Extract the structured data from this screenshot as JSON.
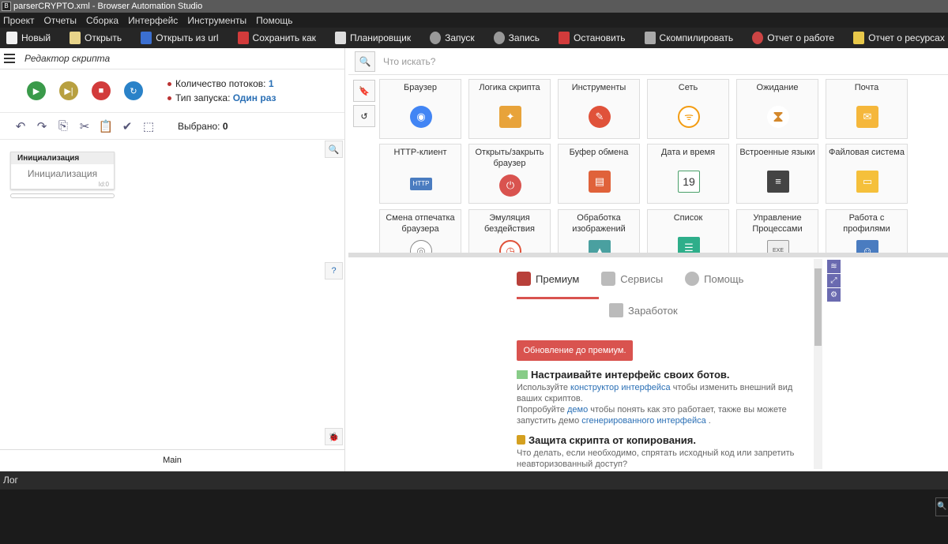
{
  "window": {
    "title": "parserCRYPTO.xml - Browser Automation Studio"
  },
  "menu": [
    "Проект",
    "Отчеты",
    "Сборка",
    "Интерфейс",
    "Инструменты",
    "Помощь"
  ],
  "toolbar": [
    {
      "label": "Новый",
      "icon": "new-file-icon",
      "color": "#f0f0f0"
    },
    {
      "label": "Открыть",
      "icon": "open-folder-icon",
      "color": "#e8d48a"
    },
    {
      "label": "Открыть из url",
      "icon": "download-arrow-icon",
      "color": "#3b6fd0"
    },
    {
      "label": "Сохранить как",
      "icon": "save-icon",
      "color": "#d23b3b"
    },
    {
      "label": "Планировщик",
      "icon": "calendar-icon",
      "color": "#ddd"
    },
    {
      "label": "Запуск",
      "icon": "play-icon",
      "color": "#999"
    },
    {
      "label": "Запись",
      "icon": "record-icon",
      "color": "#999"
    },
    {
      "label": "Остановить",
      "icon": "stop-icon",
      "color": "#d23b3b"
    },
    {
      "label": "Скомпилировать",
      "icon": "cube-icon",
      "color": "#aaa"
    },
    {
      "label": "Отчет о работе",
      "icon": "pie-chart-icon",
      "color": "#c44"
    },
    {
      "label": "Отчет о ресурсах",
      "icon": "report-icon",
      "color": "#e8c84a"
    }
  ],
  "editor": {
    "title": "Редактор скрипта",
    "threads_label": "Количество потоков:",
    "threads_value": "1",
    "launch_label": "Тип запуска:",
    "launch_value": "Один раз",
    "selected_label": "Выбрано:",
    "selected_value": "0",
    "init_header": "Инициализация",
    "init_body": "Инициализация",
    "init_id": "Id:0",
    "footer": "Main"
  },
  "search": {
    "placeholder": "Что искать?"
  },
  "modules": [
    {
      "label": "Браузер",
      "icon": "chrome-icon",
      "color": "#4285f4"
    },
    {
      "label": "Логика скрипта",
      "icon": "puzzle-icon",
      "color": "#e8a33a"
    },
    {
      "label": "Инструменты",
      "icon": "wrench-icon",
      "color": "#e0523a"
    },
    {
      "label": "Сеть",
      "icon": "wifi-icon",
      "color": "#f39c12"
    },
    {
      "label": "Ожидание",
      "icon": "hourglass-icon",
      "color": "#d4882c"
    },
    {
      "label": "Почта",
      "icon": "mail-icon",
      "color": "#f5b73b"
    },
    {
      "label": "HTTP-клиент",
      "icon": "http-icon",
      "color": "#4a7cc0"
    },
    {
      "label": "Открыть/закрыть браузер",
      "icon": "power-icon",
      "color": "#d9534f"
    },
    {
      "label": "Буфер обмена",
      "icon": "clipboard-icon",
      "color": "#e0623a"
    },
    {
      "label": "Дата и время",
      "icon": "calendar-icon",
      "color": "#4aa06a"
    },
    {
      "label": "Встроенные языки",
      "icon": "code-icon",
      "color": "#444"
    },
    {
      "label": "Файловая система",
      "icon": "folder-icon",
      "color": "#f5c03b"
    },
    {
      "label": "Смена отпечатка браузера",
      "icon": "fingerprint-icon",
      "color": "#888"
    },
    {
      "label": "Эмуляция бездействия",
      "icon": "clock-icon",
      "color": "#e0523a"
    },
    {
      "label": "Обработка изображений",
      "icon": "image-icon",
      "color": "#4aa0a0"
    },
    {
      "label": "Список",
      "icon": "list-icon",
      "color": "#2eae8a"
    },
    {
      "label": "Управление Процессами",
      "icon": "exe-icon",
      "color": "#777"
    },
    {
      "label": "Работа с профилями",
      "icon": "profile-icon",
      "color": "#4a7cc0"
    }
  ],
  "info": {
    "tabs": [
      {
        "label": "Премиум",
        "icon": "premium-icon"
      },
      {
        "label": "Сервисы",
        "icon": "cart-icon"
      },
      {
        "label": "Помощь",
        "icon": "help-icon"
      }
    ],
    "tab_earnings": "Заработок",
    "premium_button": "Обновление до премиум.",
    "sec1_title": "Настраивайте интерфейс своих ботов.",
    "sec1_p1_a": "Используйте ",
    "sec1_p1_link": "конструктор интерфейса",
    "sec1_p1_b": " чтобы изменить внешний вид ваших скриптов.",
    "sec1_p2_a": "Попробуйте ",
    "sec1_p2_link": "демо",
    "sec1_p2_b": " чтобы понять как это работает, также вы можете запустить демо ",
    "sec1_p2_link2": "сгенерированного интерфейса",
    "sec1_p2_c": " .",
    "sec2_title": "Защита скрипта от копирования.",
    "sec2_p1": "Что делать, если необходимо, спрятать исходный код или запретить неавторизованный доступ?"
  },
  "log": {
    "label": "Лог"
  }
}
